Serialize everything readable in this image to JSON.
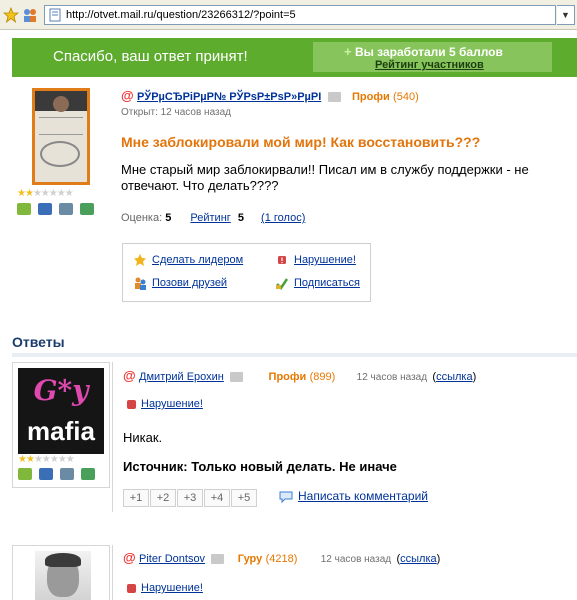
{
  "browser": {
    "url": "http://otvet.mail.ru/question/23266312/?point=5"
  },
  "banner": {
    "thanks": "Спасибо, ваш ответ принят!",
    "earned_plus": "+",
    "earned": "Вы заработали 5 баллов",
    "rating_link": "Рейтинг участников"
  },
  "question": {
    "at": "@",
    "author": "РЎРµСЂРіРµР№ РЎРѕР±РѕР»РµРІ",
    "level": "Профи",
    "points": "(540)",
    "opened": "Открыт: 12 часов назад",
    "title": "Мне заблокировали мой мир! Как восстановить???",
    "text": "Мне старый мир заблокирвали!! Писал им в службу поддержки - не отвечают. Что делать????",
    "score_label": "Оценка:",
    "score_value": "5",
    "rating_label": "Рейтинг",
    "rating_value": "5",
    "votes": "(1 голос)",
    "stars_on": 2,
    "stars_total": 7,
    "actions": {
      "make_leader": "Сделать лидером",
      "violation": "Нарушение!",
      "invite": "Позови друзей",
      "subscribe": "Подписаться"
    }
  },
  "answers_header": "Ответы",
  "answers": [
    {
      "at": "@",
      "author": "Дмитрий Ерохин",
      "level": "Профи",
      "points": "(899)",
      "time": "12 часов назад",
      "link_text": "ссылка",
      "violation": "Нарушение!",
      "text": "Никак.",
      "source": "Источник: Только новый делать. Не иначе",
      "votes": [
        "+1",
        "+2",
        "+3",
        "+4",
        "+5"
      ],
      "comment": "Написать комментарий",
      "avatar_top": "G*y",
      "avatar_bottom": "mafia",
      "stars_on": 2,
      "stars_total": 7
    },
    {
      "at": "@",
      "author": "Piter Dontsov",
      "level": "Гуру",
      "points": "(4218)",
      "time": "12 часов назад",
      "link_text": "ссылка",
      "violation": "Нарушение!"
    }
  ],
  "colors": {
    "banner_green": "#5dac2e",
    "banner_box": "#87c55c",
    "title_orange": "#e2750c",
    "link_blue": "#003399"
  }
}
